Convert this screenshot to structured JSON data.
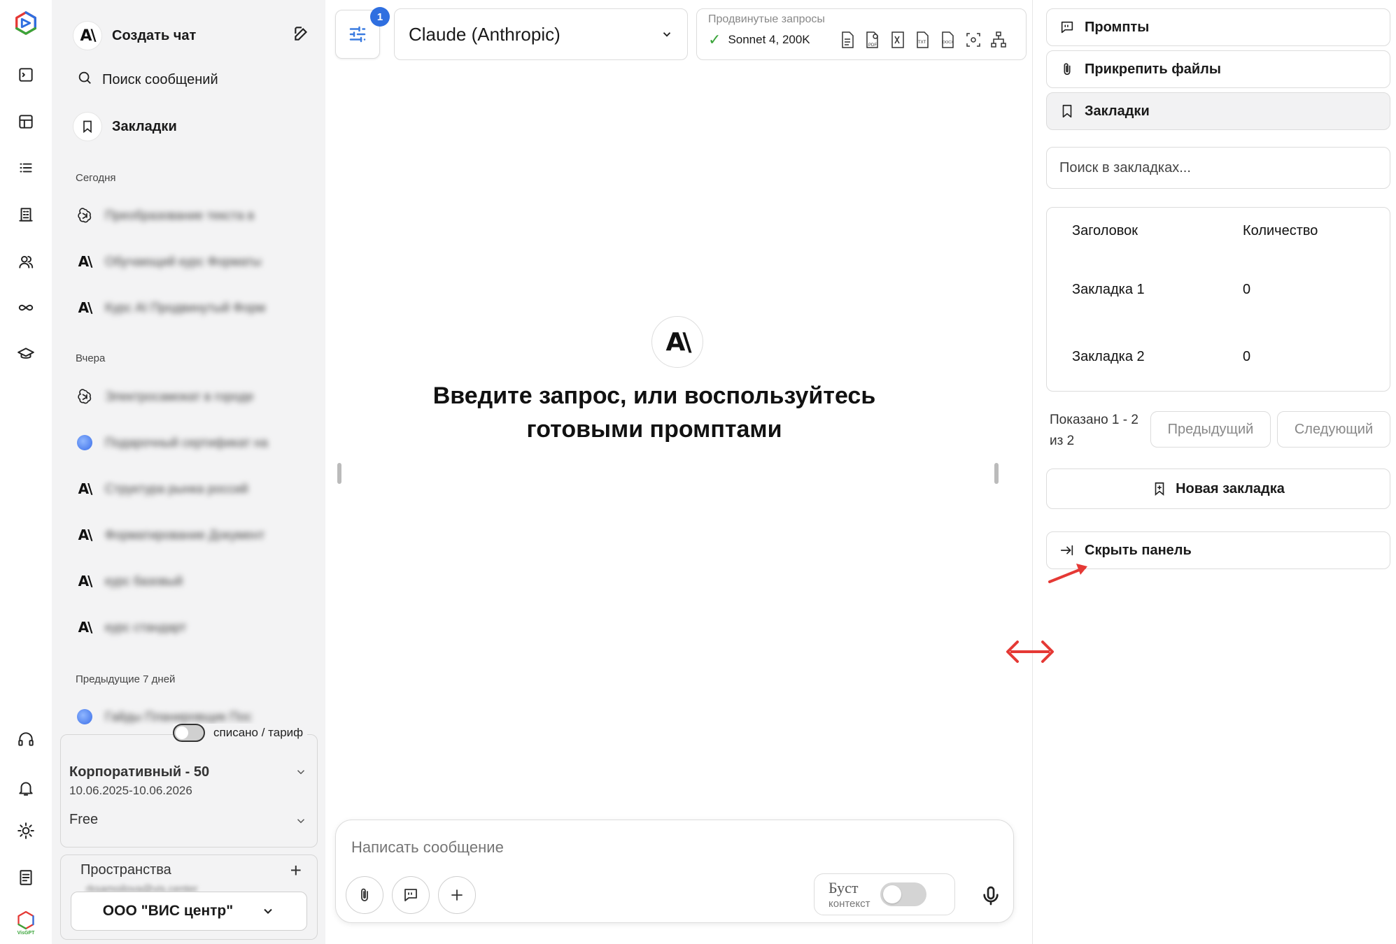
{
  "rail": {
    "icons": [
      "app-logo-icon",
      "terminal-icon",
      "table-icon",
      "list-icon",
      "building-icon",
      "users-icon",
      "infinity-icon",
      "graduation-cap-icon",
      "headset-icon",
      "bell-icon",
      "sun-icon",
      "document-icon",
      "visgpt-logo-icon"
    ],
    "logo_small_text": "VisGPT"
  },
  "sidebar": {
    "new_chat_label": "Создать чат",
    "search_label": "Поиск сообщений",
    "bookmarks_label": "Закладки",
    "sections": {
      "today": "Сегодня",
      "yesterday": "Вчера",
      "prev7": "Предыдущие 7 дней"
    },
    "today_chats": [
      {
        "icon": "openai",
        "title": "Преобразование текста в"
      },
      {
        "icon": "anthropic",
        "title": "Обучающий курс Форматы"
      },
      {
        "icon": "anthropic",
        "title": "Курс AI Продвинутый Форм"
      }
    ],
    "yesterday_chats": [
      {
        "icon": "openai",
        "title": "Электросамокат в городе"
      },
      {
        "icon": "blue",
        "title": "Подарочный сертификат на"
      },
      {
        "icon": "anthropic",
        "title": "Структура рынка россий"
      },
      {
        "icon": "anthropic",
        "title": "Форматирование Документ"
      },
      {
        "icon": "anthropic",
        "title": "курс базовый"
      },
      {
        "icon": "anthropic",
        "title": "курс стандарт"
      }
    ],
    "prev7_chats": [
      {
        "icon": "blue",
        "title": "Гайды Планировщик Пос"
      }
    ],
    "balance_toggle_label": "списано / тариф",
    "plan_name": "Корпоративный - 50",
    "plan_dates": "10.06.2025-10.06.2026",
    "plan_tier": "Free",
    "spaces_label": "Пространства",
    "spaces_email": "rksamoilova@vis.center",
    "spaces_org": "ООО \"ВИС центр\""
  },
  "main": {
    "settings_badge": "1",
    "model_name": "Claude (Anthropic)",
    "advanced_label": "Продвинутые запросы",
    "advanced_model": "Sonnet 4, 200K",
    "advanced_icons": [
      "file-text-icon",
      "pdf-search-icon",
      "excel-icon",
      "txt-file-icon",
      "docx-file-icon",
      "scan-icon",
      "sitemap-icon"
    ],
    "welcome_text": "Введите запрос, или воспользуйтесь готовыми промптами",
    "composer_placeholder": "Написать сообщение",
    "boost_label": "Буст",
    "boost_sub": "контекст"
  },
  "right_panel": {
    "prompts_label": "Промпты",
    "attach_label": "Прикрепить файлы",
    "bookmarks_label": "Закладки",
    "search_placeholder": "Поиск в закладках...",
    "table": {
      "headers": [
        "Заголовок",
        "Количество"
      ],
      "rows": [
        {
          "title": "Закладка 1",
          "count": "0"
        },
        {
          "title": "Закладка 2",
          "count": "0"
        }
      ]
    },
    "pager_text": "Показано 1 - 2 из 2",
    "prev_label": "Предыдущий",
    "next_label": "Следующий",
    "new_bookmark_label": "Новая закладка",
    "hide_panel_label": "Скрыть панель"
  },
  "colors": {
    "accent_blue": "#2f6fe0",
    "annotation_red": "#e53935",
    "sidebar_bg": "#f3f3f4",
    "check_green": "#3aa53a"
  }
}
